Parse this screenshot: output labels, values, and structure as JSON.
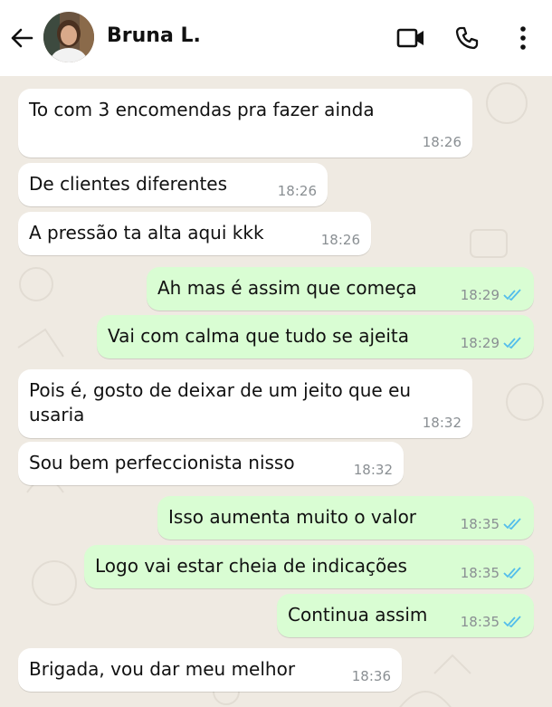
{
  "header": {
    "contact_name": "Bruna L.",
    "icons": [
      "back-arrow-icon",
      "video-call-icon",
      "phone-call-icon",
      "more-options-icon"
    ]
  },
  "colors": {
    "chat_background": "#efeae2",
    "incoming_bubble": "#ffffff",
    "outgoing_bubble": "#d9fdd3",
    "read_ticks": "#53bdeb"
  },
  "messages": [
    {
      "direction": "in",
      "text": "To com 3 encomendas pra fazer ainda",
      "time": "18:26"
    },
    {
      "direction": "in",
      "text": "De clientes diferentes",
      "time": "18:26"
    },
    {
      "direction": "in",
      "text": "A pressão ta alta aqui kkk",
      "time": "18:26"
    },
    {
      "direction": "out",
      "text": "Ah mas é assim que começa",
      "time": "18:29",
      "status": "read"
    },
    {
      "direction": "out",
      "text": "Vai com calma que tudo se ajeita",
      "time": "18:29",
      "status": "read"
    },
    {
      "direction": "in",
      "text": "Pois é, gosto de deixar de um jeito que eu\nusaria",
      "time": "18:32"
    },
    {
      "direction": "in",
      "text": "Sou bem perfeccionista nisso",
      "time": "18:32"
    },
    {
      "direction": "out",
      "text": "Isso aumenta muito o valor",
      "time": "18:35",
      "status": "read"
    },
    {
      "direction": "out",
      "text": "Logo vai estar cheia de indicações",
      "time": "18:35",
      "status": "read"
    },
    {
      "direction": "out",
      "text": "Continua assim",
      "time": "18:35",
      "status": "read"
    },
    {
      "direction": "in",
      "text": "Brigada, vou dar meu melhor",
      "time": "18:36"
    }
  ]
}
